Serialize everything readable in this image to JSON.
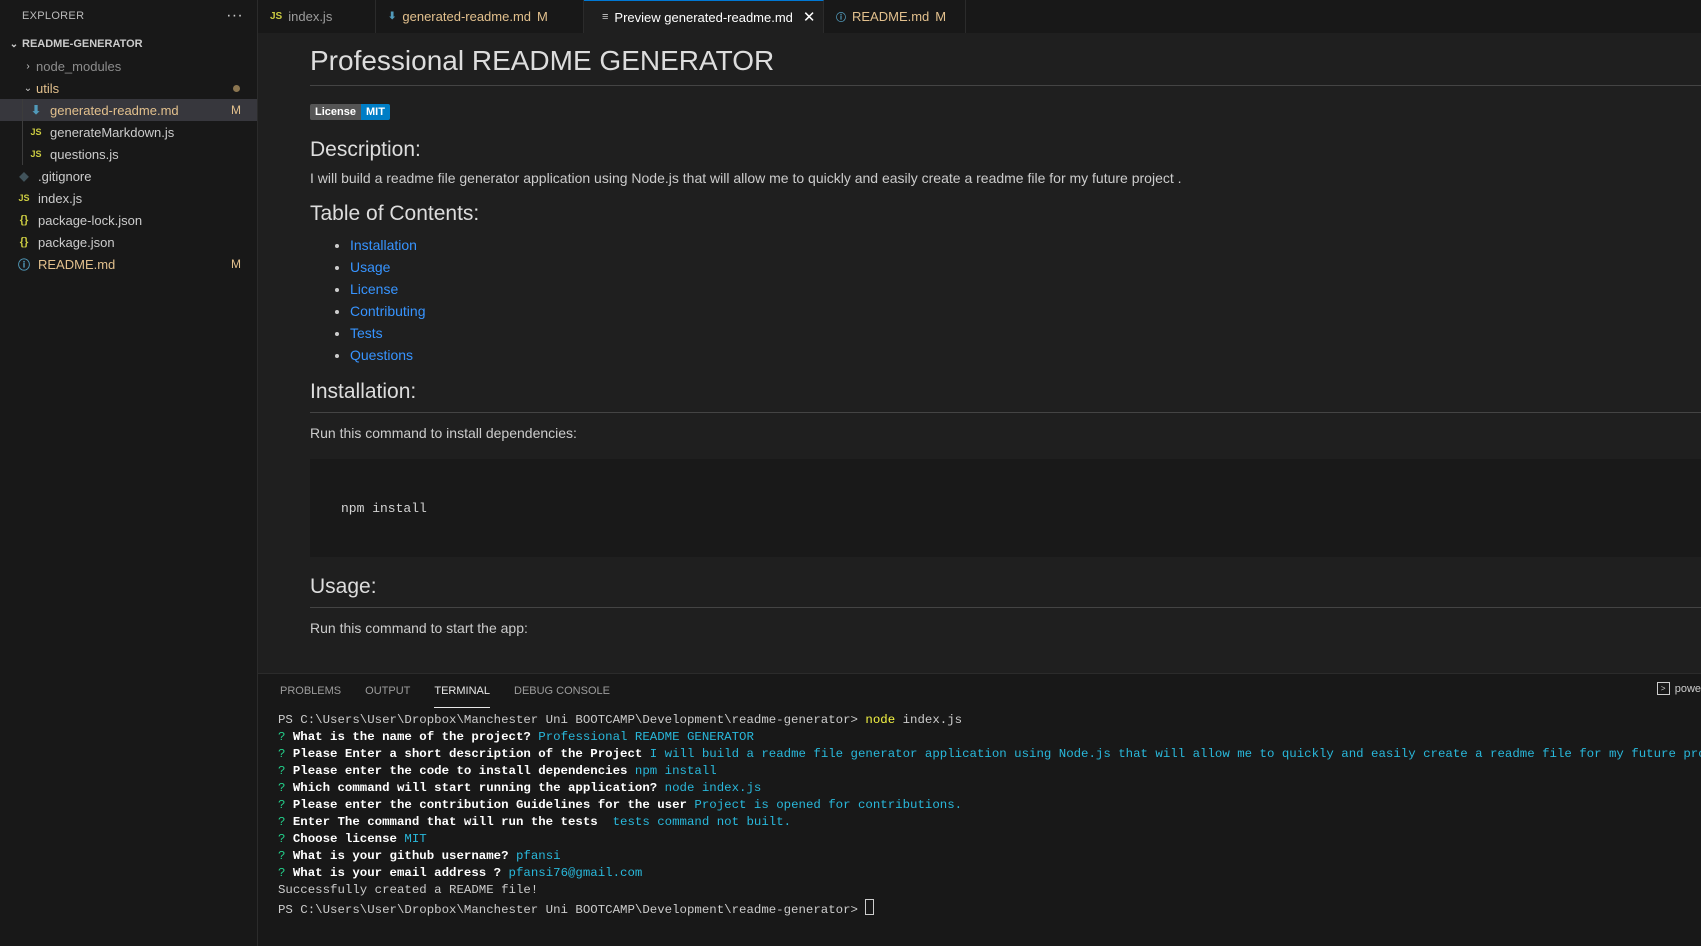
{
  "explorer": {
    "title": "EXPLORER",
    "more": "···",
    "root": "README-GENERATOR",
    "items": [
      {
        "label": "node_modules",
        "badge": ""
      },
      {
        "label": "utils",
        "badge": ""
      },
      {
        "label": "generated-readme.md",
        "badge": "M"
      },
      {
        "label": "generateMarkdown.js",
        "badge": ""
      },
      {
        "label": "questions.js",
        "badge": ""
      },
      {
        "label": ".gitignore",
        "badge": ""
      },
      {
        "label": "index.js",
        "badge": ""
      },
      {
        "label": "package-lock.json",
        "badge": ""
      },
      {
        "label": "package.json",
        "badge": ""
      },
      {
        "label": "README.md",
        "badge": "M"
      }
    ]
  },
  "tabs": [
    {
      "label": "index.js",
      "mod": ""
    },
    {
      "label": "generated-readme.md",
      "mod": "M"
    },
    {
      "label": "Preview generated-readme.md",
      "mod": ""
    },
    {
      "label": "README.md",
      "mod": "M"
    }
  ],
  "preview": {
    "title": "Professional README GENERATOR",
    "badge_left": "License",
    "badge_right": "MIT",
    "description_heading": "Description:",
    "description": "I will build a readme file generator application using Node.js that will allow me to quickly and easily create a readme file for my future project .",
    "toc_heading": "Table of Contents:",
    "toc": [
      "Installation",
      "Usage",
      "License",
      "Contributing",
      "Tests",
      "Questions"
    ],
    "installation_heading": "Installation:",
    "installation_text": "Run this command to install dependencies:",
    "installation_code": "npm install",
    "usage_heading": "Usage:",
    "usage_text": "Run this command to start the app:"
  },
  "panel": {
    "tabs": [
      "PROBLEMS",
      "OUTPUT",
      "TERMINAL",
      "DEBUG CONSOLE"
    ],
    "shell": "powe",
    "prompt": "PS C:\\Users\\User\\Dropbox\\Manchester Uni BOOTCAMP\\Development\\readme-generator> ",
    "command_node": "node",
    "command_arg": " index.js",
    "qa": [
      {
        "q": "What is the name of the project?",
        "a": "Professional README GENERATOR"
      },
      {
        "q": "Please Enter a short description of the Project",
        "a": "I will build a readme file generator application using Node.js that will allow me to quickly and easily create a readme file for my future project ."
      },
      {
        "q": "Please enter the code to install dependencies",
        "a": "npm install"
      },
      {
        "q": "Which command will start running the application?",
        "a": "node index.js"
      },
      {
        "q": "Please enter the contribution Guidelines for the user",
        "a": "Project is opened for contributions."
      },
      {
        "q": "Enter The command that will run the tests ",
        "a": "tests command not built."
      },
      {
        "q": "Choose license",
        "a": "MIT"
      },
      {
        "q": "What is your github username?",
        "a": "pfansi"
      },
      {
        "q": "What is your email address ?",
        "a": "pfansi76@gmail.com"
      }
    ],
    "success": "Successfully created a README file!"
  }
}
